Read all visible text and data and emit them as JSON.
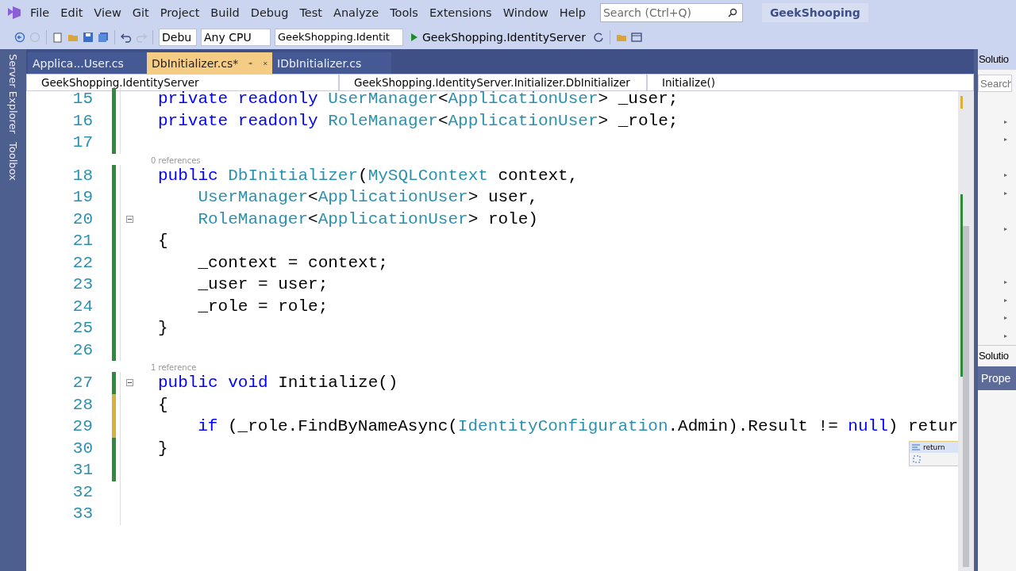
{
  "menu": [
    "File",
    "Edit",
    "View",
    "Git",
    "Project",
    "Build",
    "Debug",
    "Test",
    "Analyze",
    "Tools",
    "Extensions",
    "Window",
    "Help"
  ],
  "search": {
    "placeholder": "Search (Ctrl+Q)"
  },
  "solution_name": "GeekShooping",
  "toolbar": {
    "configuration": "Debu",
    "platform": "Any CPU",
    "startup_project": "GeekShopping.Identit",
    "run_target": "GeekShopping.IdentityServer"
  },
  "left_rail": [
    "Server Explorer",
    "Toolbox"
  ],
  "tabs": [
    {
      "label": "Applica...User.cs",
      "selected": false
    },
    {
      "label": "DbInitializer.cs*",
      "selected": true
    },
    {
      "label": "IDbInitializer.cs",
      "selected": false
    }
  ],
  "nav_bar": {
    "project": "GeekShopping.IdentityServer",
    "type": "GeekShopping.IdentityServer.Initializer.DbInitializer",
    "member": "Initialize()"
  },
  "code_lines": [
    {
      "number": "15",
      "kind": "saved",
      "collapsible": false,
      "indented": false,
      "tokens": [
        {
          "kind": "keyword",
          "text": "private readonly "
        },
        {
          "kind": "type",
          "text": "UserManager"
        },
        {
          "kind": "plain",
          "text": "<"
        },
        {
          "kind": "type",
          "text": "ApplicationUser"
        },
        {
          "kind": "plain",
          "text": "> _user;"
        }
      ]
    },
    {
      "number": "16",
      "kind": "saved",
      "collapsible": false,
      "indented": false,
      "tokens": [
        {
          "kind": "keyword",
          "text": "private readonly "
        },
        {
          "kind": "type",
          "text": "RoleManager"
        },
        {
          "kind": "plain",
          "text": "<"
        },
        {
          "kind": "type",
          "text": "ApplicationUser"
        },
        {
          "kind": "plain",
          "text": "> _role;"
        }
      ]
    },
    {
      "number": "17",
      "kind": "saved",
      "collapsible": false
    },
    {
      "number": "18",
      "kind": "saved",
      "collapsible": false,
      "indented": false,
      "lens": "0 references",
      "tokens": [
        {
          "kind": "keyword",
          "text": "public "
        },
        {
          "kind": "type",
          "text": "DbInitializer"
        },
        {
          "kind": "plain",
          "text": "("
        },
        {
          "kind": "type",
          "text": "MySQLContext"
        },
        {
          "kind": "plain",
          "text": " context,"
        }
      ]
    },
    {
      "number": "19",
      "kind": "saved",
      "collapsible": false,
      "indented": true,
      "tokens": [
        {
          "kind": "type",
          "text": "UserManager"
        },
        {
          "kind": "plain",
          "text": "<"
        },
        {
          "kind": "type",
          "text": "ApplicationUser"
        },
        {
          "kind": "plain",
          "text": "> user,"
        }
      ]
    },
    {
      "number": "20",
      "kind": "saved",
      "collapsible": true,
      "indented": true,
      "tokens": [
        {
          "kind": "type",
          "text": "RoleManager"
        },
        {
          "kind": "plain",
          "text": "<"
        },
        {
          "kind": "type",
          "text": "ApplicationUser"
        },
        {
          "kind": "plain",
          "text": "> role)"
        }
      ]
    },
    {
      "number": "21",
      "kind": "saved",
      "collapsible": false,
      "indented": false,
      "tokens": [
        {
          "kind": "plain",
          "text": "{"
        }
      ]
    },
    {
      "number": "22",
      "kind": "saved",
      "collapsible": false,
      "indented": true,
      "tokens": [
        {
          "kind": "plain",
          "text": "_context = context;"
        }
      ]
    },
    {
      "number": "23",
      "kind": "saved",
      "collapsible": false,
      "indented": true,
      "tokens": [
        {
          "kind": "plain",
          "text": "_user = user;"
        }
      ]
    },
    {
      "number": "24",
      "kind": "saved",
      "collapsible": false,
      "indented": true,
      "tokens": [
        {
          "kind": "plain",
          "text": "_role = role;"
        }
      ]
    },
    {
      "number": "25",
      "kind": "saved",
      "collapsible": false,
      "indented": false,
      "tokens": [
        {
          "kind": "plain",
          "text": "}"
        }
      ]
    },
    {
      "number": "26",
      "kind": "saved",
      "collapsible": false
    },
    {
      "number": "27",
      "kind": "saved",
      "collapsible": true,
      "indented": false,
      "lens": "1 reference",
      "tokens": [
        {
          "kind": "keyword",
          "text": "public void "
        },
        {
          "kind": "plain",
          "text": "Initialize()"
        }
      ]
    },
    {
      "number": "28",
      "kind": "unsaved",
      "collapsible": false,
      "indented": false,
      "tokens": [
        {
          "kind": "plain",
          "text": "{"
        }
      ]
    },
    {
      "number": "29",
      "kind": "unsaved",
      "collapsible": false,
      "indented": true,
      "tokens": [
        {
          "kind": "keyword",
          "text": "if"
        },
        {
          "kind": "plain",
          "text": " (_role.FindByNameAsync("
        },
        {
          "kind": "type",
          "text": "IdentityConfiguration"
        },
        {
          "kind": "plain",
          "text": ".Admin).Result != "
        },
        {
          "kind": "keyword",
          "text": "null"
        },
        {
          "kind": "plain",
          "text": ") retur"
        }
      ]
    },
    {
      "number": "30",
      "kind": "saved",
      "collapsible": false,
      "indented": false,
      "tokens": [
        {
          "kind": "plain",
          "text": "}"
        }
      ]
    },
    {
      "number": "31",
      "kind": "saved",
      "collapsible": false
    },
    {
      "number": "32",
      "kind": "unchanged",
      "collapsible": false
    },
    {
      "number": "33",
      "kind": "unchanged",
      "collapsible": false
    }
  ],
  "completion": {
    "suggestion": "return"
  },
  "right_panel": {
    "title": "Solutio",
    "search_placeholder": "Search",
    "tab": "Solutio",
    "properties_title": "Prope"
  }
}
